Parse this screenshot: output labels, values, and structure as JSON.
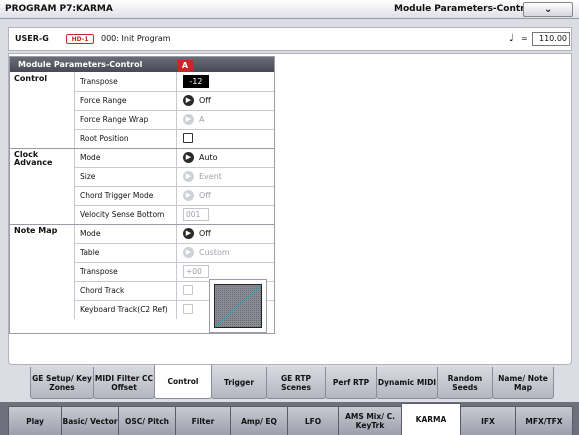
{
  "window": {
    "mode_page": "PROGRAM P7:KARMA",
    "page_title": "Module Parameters-Control",
    "menu_icon": "chevron-down-icon"
  },
  "program": {
    "bank": "USER-G",
    "badge": "HD-1",
    "name": "000: Init Program",
    "tempo_symbol": "♩",
    "tempo_eq": "=",
    "tempo": "110.00"
  },
  "section": {
    "title": "Module Parameters-Control",
    "module_tag": "A"
  },
  "groups": {
    "control": "Control",
    "clock": "Clock Advance",
    "notemap": "Note Map"
  },
  "params": {
    "transpose": {
      "label": "Transpose",
      "value": "-12"
    },
    "force_range": {
      "label": "Force Range",
      "value": "Off"
    },
    "force_range_wrap": {
      "label": "Force Range Wrap",
      "value": "A"
    },
    "root_position": {
      "label": "Root Position",
      "checked": false
    },
    "ca_mode": {
      "label": "Mode",
      "value": "Auto"
    },
    "ca_size": {
      "label": "Size",
      "value": "Event"
    },
    "ca_chord_trigger": {
      "label": "Chord Trigger Mode",
      "value": "Off"
    },
    "ca_vel_sense": {
      "label": "Velocity Sense Bottom",
      "value": "001"
    },
    "nm_mode": {
      "label": "Mode",
      "value": "Off"
    },
    "nm_table": {
      "label": "Table",
      "value": "Custom"
    },
    "nm_transpose": {
      "label": "Transpose",
      "value": "+00"
    },
    "nm_chord_track": {
      "label": "Chord Track",
      "checked": false
    },
    "nm_keyboard_track": {
      "label": "Keyboard Track(C2 Ref)",
      "checked": false
    }
  },
  "page_tabs": [
    {
      "label": "GE Setup/ Key Zones"
    },
    {
      "label": "MIDI Filter CC Offset"
    },
    {
      "label": "Control",
      "active": true
    },
    {
      "label": "Trigger"
    },
    {
      "label": "GE RTP Scenes"
    },
    {
      "label": "Perf RTP"
    },
    {
      "label": "Dynamic MIDI"
    },
    {
      "label": "Random Seeds"
    },
    {
      "label": "Name/ Note Map"
    }
  ],
  "mode_tabs": [
    {
      "label": "Play"
    },
    {
      "label": "Basic/ Vector"
    },
    {
      "label": "OSC/ Pitch"
    },
    {
      "label": "Filter"
    },
    {
      "label": "Amp/ EQ"
    },
    {
      "label": "LFO"
    },
    {
      "label": "AMS Mix/ C. KeyTrk"
    },
    {
      "label": "KARMA",
      "active": true
    },
    {
      "label": "IFX"
    },
    {
      "label": "MFX/TFX"
    }
  ],
  "colors": {
    "accent_red": "#c62828",
    "header_dark": "#474955",
    "graph_line": "#3aa0b0"
  }
}
